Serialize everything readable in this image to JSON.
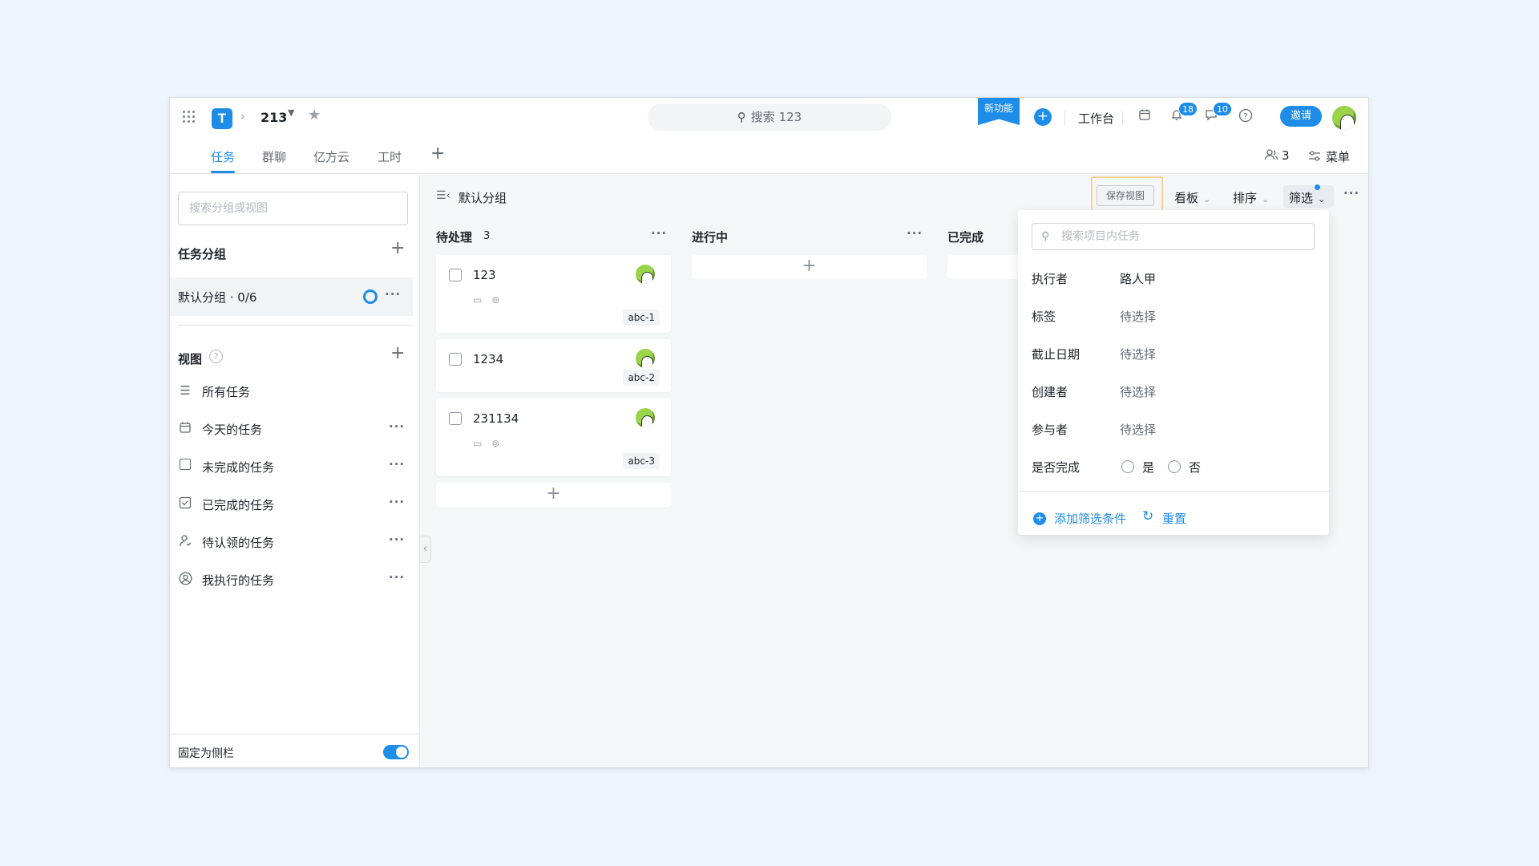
{
  "topbar": {
    "project_name": "213",
    "search_placeholder": "搜索 123",
    "new_feature_label": "新功能",
    "workbench_label": "工作台",
    "notif_badge": "18",
    "message_badge": "10",
    "invite_label": "邀请"
  },
  "tabs": {
    "items": [
      {
        "label": "任务"
      },
      {
        "label": "群聊"
      },
      {
        "label": "亿方云"
      },
      {
        "label": "工时"
      }
    ],
    "add": "+",
    "members_count": "3",
    "menu_label": "菜单"
  },
  "sidebar": {
    "search_placeholder": "搜索分组或视图",
    "groups_title": "任务分组",
    "group_item": "默认分组 · 0/6",
    "views_title": "视图",
    "views": [
      {
        "label": "所有任务",
        "icon": "list-icon"
      },
      {
        "label": "今天的任务",
        "icon": "calendar-icon"
      },
      {
        "label": "未完成的任务",
        "icon": "checkbox-empty-icon"
      },
      {
        "label": "已完成的任务",
        "icon": "checkbox-checked-icon"
      },
      {
        "label": "待认领的任务",
        "icon": "user-claim-icon"
      },
      {
        "label": "我执行的任务",
        "icon": "user-circle-icon"
      }
    ],
    "pin_label": "固定为侧栏",
    "pin_enabled": true
  },
  "board": {
    "title": "默认分组",
    "save_view_label": "保存视图",
    "toolbar": {
      "kanban": "看板",
      "sort": "排序",
      "filter": "筛选"
    },
    "columns": [
      {
        "title": "待处理",
        "count": "3",
        "cards": [
          {
            "title": "123",
            "tag": "abc-1"
          },
          {
            "title": "1234",
            "tag": "abc-2"
          },
          {
            "title": "231134",
            "tag": "abc-3"
          }
        ]
      },
      {
        "title": "进行中",
        "count": "",
        "cards": []
      },
      {
        "title": "已完成",
        "count": "",
        "cards": []
      }
    ]
  },
  "filter_panel": {
    "search_placeholder": "搜索项目内任务",
    "rows": [
      {
        "label": "执行者",
        "value": "路人甲"
      },
      {
        "label": "标签",
        "value": "待选择"
      },
      {
        "label": "截止日期",
        "value": "待选择"
      },
      {
        "label": "创建者",
        "value": "待选择"
      },
      {
        "label": "参与者",
        "value": "待选择"
      }
    ],
    "completed_label": "是否完成",
    "yes_label": "是",
    "no_label": "否",
    "add_condition_label": "添加筛选条件",
    "reset_label": "重置"
  },
  "colors": {
    "accent": "#1e8de8",
    "highlight_outline": "#f6d39a"
  }
}
